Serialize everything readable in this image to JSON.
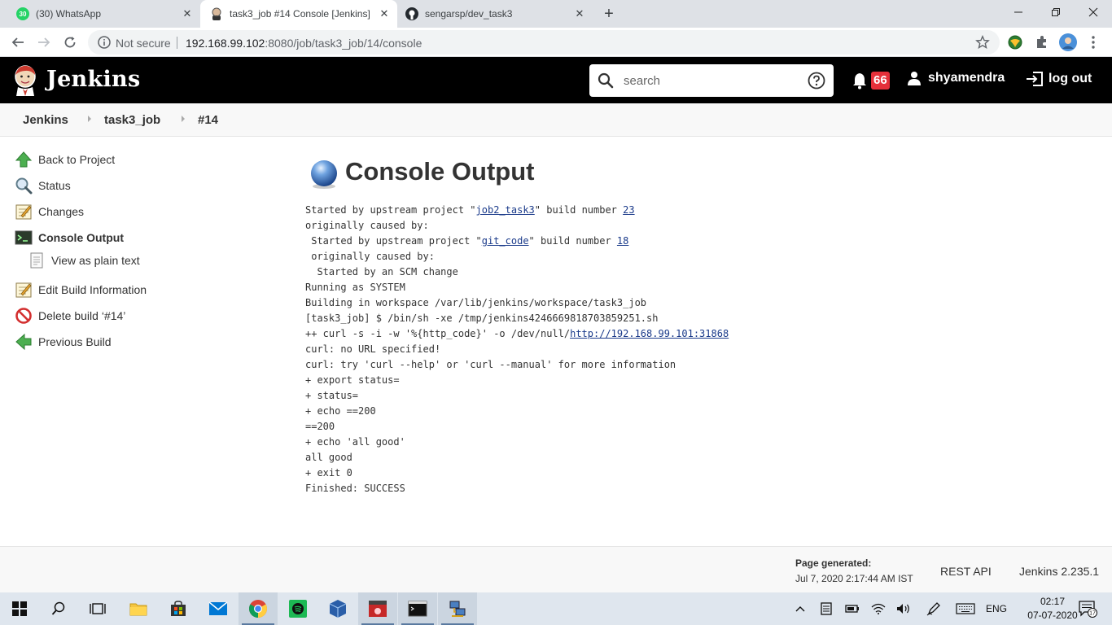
{
  "browser": {
    "tabs": [
      {
        "title": "(30) WhatsApp",
        "badge": "30"
      },
      {
        "title": "task3_job #14 Console [Jenkins]"
      },
      {
        "title": "sengarsp/dev_task3"
      }
    ],
    "new_tab_label": "+",
    "omnibox": {
      "security": "Not secure",
      "url_host": "192.168.99.102",
      "url_rest": ":8080/job/task3_job/14/console"
    }
  },
  "jenkins_header": {
    "title": "Jenkins",
    "search_placeholder": "search",
    "notification_count": "66",
    "user": "shyamendra",
    "logout": "log out"
  },
  "breadcrumb": [
    "Jenkins",
    "task3_job",
    "#14"
  ],
  "side_panel": [
    {
      "label": "Back to Project",
      "icon": "up-arrow-icon"
    },
    {
      "label": "Status",
      "icon": "magnifier-icon"
    },
    {
      "label": "Changes",
      "icon": "notepad-icon"
    },
    {
      "label": "Console Output",
      "icon": "terminal-icon"
    },
    {
      "label": "View as plain text",
      "icon": "document-icon"
    },
    {
      "label": "Edit Build Information",
      "icon": "notepad-icon"
    },
    {
      "label": "Delete build ‘#14’",
      "icon": "no-entry-icon"
    },
    {
      "label": "Previous Build",
      "icon": "left-arrow-icon"
    }
  ],
  "main": {
    "title": "Console Output",
    "console": {
      "line1_pre": "Started by upstream project \"",
      "line1_link": "job2_task3",
      "line1_mid": "\" build number ",
      "line1_num": "23",
      "line2": "originally caused by:",
      "line3_pre": " Started by upstream project \"",
      "line3_link": "git_code",
      "line3_mid": "\" build number ",
      "line3_num": "18",
      "line4": " originally caused by:",
      "line5": "  Started by an SCM change",
      "line6": "Running as SYSTEM",
      "line7": "Building in workspace /var/lib/jenkins/workspace/task3_job",
      "line8": "[task3_job] $ /bin/sh -xe /tmp/jenkins4246669818703859251.sh",
      "line9_pre": "++ curl -s -i -w '%{http_code}' -o /dev/null/",
      "line9_link": "http://192.168.99.101:31868",
      "line10": "curl: no URL specified!",
      "line11": "curl: try 'curl --help' or 'curl --manual' for more information",
      "line12": "+ export status=",
      "line13": "+ status=",
      "line14": "+ echo ==200",
      "line15": "==200",
      "line16": "+ echo 'all good'",
      "line17": "all good",
      "line18": "+ exit 0",
      "line19": "Finished: SUCCESS"
    }
  },
  "footer": {
    "page_generated_label": "Page generated:",
    "page_generated_date": "Jul 7, 2020 2:17:44 AM IST",
    "rest_api": "REST API",
    "version": "Jenkins 2.235.1"
  },
  "taskbar": {
    "language": "ENG",
    "time": "02:17",
    "date": "07-07-2020",
    "notification_count": "17"
  },
  "colors": {
    "jenkins_header_bg": "#000000",
    "notification_badge": "#e5303a",
    "link": "#1a3a8a"
  }
}
